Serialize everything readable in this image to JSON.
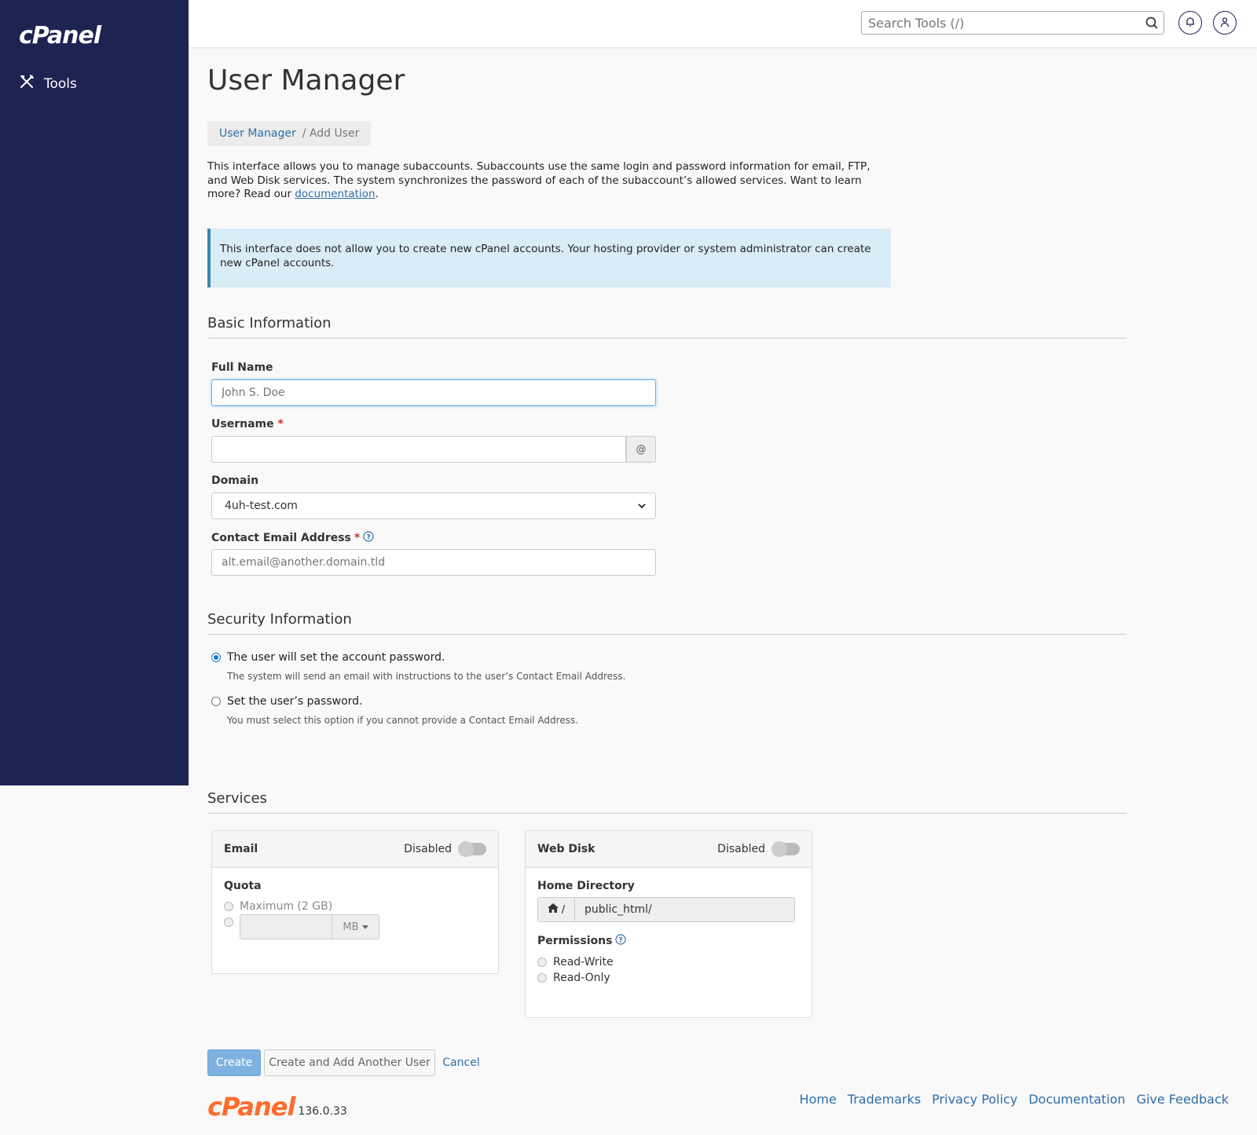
{
  "sidebar": {
    "logo": "cPanel",
    "items": [
      {
        "label": "Tools"
      }
    ]
  },
  "topbar": {
    "search_placeholder": "Search Tools (/)"
  },
  "page": {
    "title": "User Manager",
    "breadcrumb": {
      "parent": "User Manager",
      "current": "/ Add User"
    },
    "intro_text": "This interface allows you to manage subaccounts. Subaccounts use the same login and password information for email, FTP, and Web Disk services. The system synchronizes the password of each of the subaccount’s allowed services. Want to learn more? Read our ",
    "intro_link": "documentation",
    "intro_end": ".",
    "alert": "This interface does not allow you to create new cPanel accounts. Your hosting provider or system administrator can create new cPanel accounts."
  },
  "basic": {
    "heading": "Basic Information",
    "full_name_label": "Full Name",
    "full_name_placeholder": "John S. Doe",
    "username_label": "Username",
    "username_addon": "@",
    "domain_label": "Domain",
    "domain_value": "4uh-test.com",
    "contact_label": "Contact Email Address",
    "contact_placeholder": "alt.email@another.domain.tld",
    "required_mark": "*"
  },
  "security": {
    "heading": "Security Information",
    "option1": "The user will set the account password.",
    "option1_help": "The system will send an email with instructions to the user’s Contact Email Address.",
    "option2": "Set the user’s password.",
    "option2_help": "You must select this option if you cannot provide a Contact Email Address."
  },
  "services": {
    "heading": "Services",
    "email": {
      "title": "Email",
      "status": "Disabled",
      "quota_label": "Quota",
      "max_option": "Maximum (2 GB)",
      "unit": "MB"
    },
    "webdisk": {
      "title": "Web Disk",
      "status": "Disabled",
      "home_label": "Home Directory",
      "home_prefix": "/",
      "home_value": "public_html/",
      "perm_label": "Permissions",
      "perm_rw": "Read-Write",
      "perm_ro": "Read-Only"
    }
  },
  "actions": {
    "create": "Create",
    "create_another": "Create and Add Another User",
    "cancel": "Cancel"
  },
  "footer": {
    "logo": "cPanel",
    "version": "136.0.33",
    "links": [
      "Home",
      "Trademarks",
      "Privacy Policy",
      "Documentation",
      "Give Feedback"
    ]
  },
  "colors": {
    "sidebar": "#1e2452",
    "link": "#2f6da9",
    "brand_orange": "#ff6c2c",
    "alert_bg": "#d9edf7"
  }
}
